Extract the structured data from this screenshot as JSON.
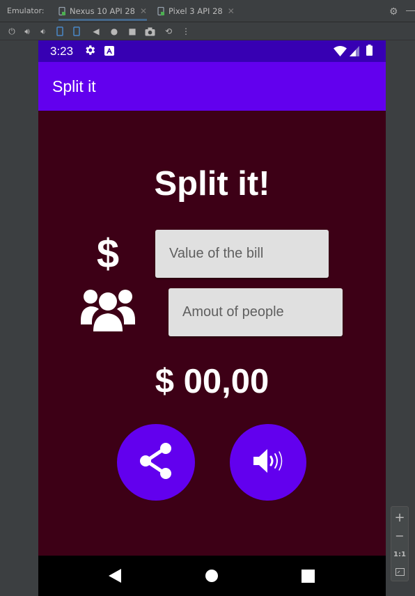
{
  "ide": {
    "emulator_label": "Emulator:",
    "tabs": [
      {
        "label": "Nexus 10 API 28",
        "active": true
      },
      {
        "label": "Pixel 3 API 28",
        "active": false
      }
    ],
    "zoom": {
      "in": "+",
      "out": "−",
      "actual": "1:1"
    }
  },
  "status_bar": {
    "time": "3:23"
  },
  "app_bar": {
    "title": "Split it"
  },
  "main": {
    "heading": "Split it!",
    "bill_placeholder": "Value of the bill",
    "people_placeholder": "Amout of people",
    "dollar_symbol": "$",
    "result": "$ 00,00"
  },
  "colors": {
    "status_bar": "#3700b3",
    "app_bar": "#6200ee",
    "background": "#3d0016",
    "fab": "#6200ee"
  }
}
